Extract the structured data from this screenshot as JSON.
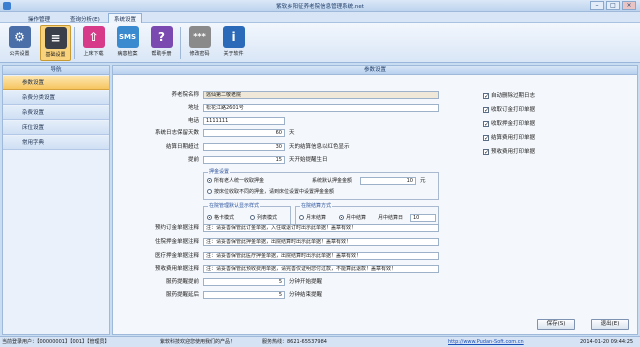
{
  "window": {
    "title": "紫软乡阳征养老院信息管理系统.net"
  },
  "menu": {
    "tabs": [
      {
        "label": "操作管理"
      },
      {
        "label": "查询分析(E)"
      },
      {
        "label": "系统设置"
      }
    ]
  },
  "ribbon": {
    "buttons": [
      {
        "label": "公共设置",
        "icon": "home-settings-icon",
        "color": "#4a6fa8"
      },
      {
        "label": "基础设置",
        "icon": "sliders-icon",
        "color": "#3a3f4a"
      },
      {
        "label": "上床下载",
        "icon": "upload-icon",
        "color": "#d83a8a"
      },
      {
        "label": "病患检案",
        "icon": "sms-icon",
        "color": "#3a8ad0"
      },
      {
        "label": "帮助手册",
        "icon": "help-icon",
        "color": "#7a4ab0"
      },
      {
        "label": "修改密码",
        "icon": "password-icon",
        "color": "#8a8a8a"
      },
      {
        "label": "关于软件",
        "icon": "info-icon",
        "color": "#2a6ab8"
      }
    ]
  },
  "nav": {
    "title": "导航",
    "items": [
      {
        "label": "参数设置"
      },
      {
        "label": "杂费分类设置"
      },
      {
        "label": "杂费设置"
      },
      {
        "label": "床位设置"
      },
      {
        "label": "常用字典"
      }
    ]
  },
  "content": {
    "title": "参数设置"
  },
  "form": {
    "name_label": "养老院名称",
    "name_value": "逃仙第二敬老院",
    "addr_label": "地址",
    "addr_value": "松花江路2601号",
    "phone_label": "电话",
    "phone_value": "1111111",
    "log_label": "系统日志保留天数",
    "log_value": "60",
    "log_unit": "天",
    "settle_label": "结算日期超过",
    "settle_value": "30",
    "settle_after": "天的结算信息以红色显示",
    "remind_label": "提前",
    "remind_value": "15",
    "remind_after": "天开始提醒生日",
    "deposit": {
      "title": "押金设置",
      "opt1": "所有老人统一收取押金",
      "default_label": "系统默认押金金额",
      "default_value": "10",
      "unit": "元",
      "opt2": "按床位收取不同的押金，请到床位设置中设置押金金额"
    },
    "display": {
      "title": "在院管理默认显示样式",
      "opt1": "格卡模式",
      "opt2": "列表模式"
    },
    "billing": {
      "title": "在院结算方式",
      "opt1": "月末结算",
      "opt2": "月中结算",
      "day_label": "月中结算日",
      "day_value": "10"
    },
    "prepay_label": "预约订金单据注释",
    "prepay_value": "注：请妥善保管此订金单据，入住或退订时出示此单据！盖章有效！",
    "inhouse_label": "住院押金单据注释",
    "inhouse_value": "注：请妥善保管此押金单据，出院结算时出示此单据！盖章有效！",
    "medical_label": "医疗押金单据注释",
    "medical_value": "注：请妥善保管此医疗押金单据，出院结算时出示此单据！盖章有效！",
    "prefee_label": "预收费用单据注释",
    "prefee_value": "注：请妥善保管此预收费用单据，请完善仅证明您付过款，不能算此退款！盖章有效！",
    "startlabel": "服药提醒提前",
    "start_value": "5",
    "start_unit": "分钟开始提醒",
    "delaylabel": "服药提醒延后",
    "delay_value": "5",
    "delay_unit": "分钟结束提醒"
  },
  "checks": [
    {
      "label": "自动删除过期日志",
      "checked": true
    },
    {
      "label": "收取订金打印单据",
      "checked": true
    },
    {
      "label": "收取押金打印单据",
      "checked": true
    },
    {
      "label": "结算费用打印单据",
      "checked": true
    },
    {
      "label": "预收费用打印单据",
      "checked": true
    }
  ],
  "buttons": {
    "save": "保存(S)",
    "exit": "退出(E)"
  },
  "status": {
    "user": "当前登录用户：【00000001】【001】【管理员】",
    "welcome": "紫软科技欢迎您使用我们的产品！",
    "hotline": "服务热线：8621-65537984",
    "website": "http://www.Pudan-Soft.com.cn",
    "datetime": "2014-01-20 09:44:25"
  }
}
